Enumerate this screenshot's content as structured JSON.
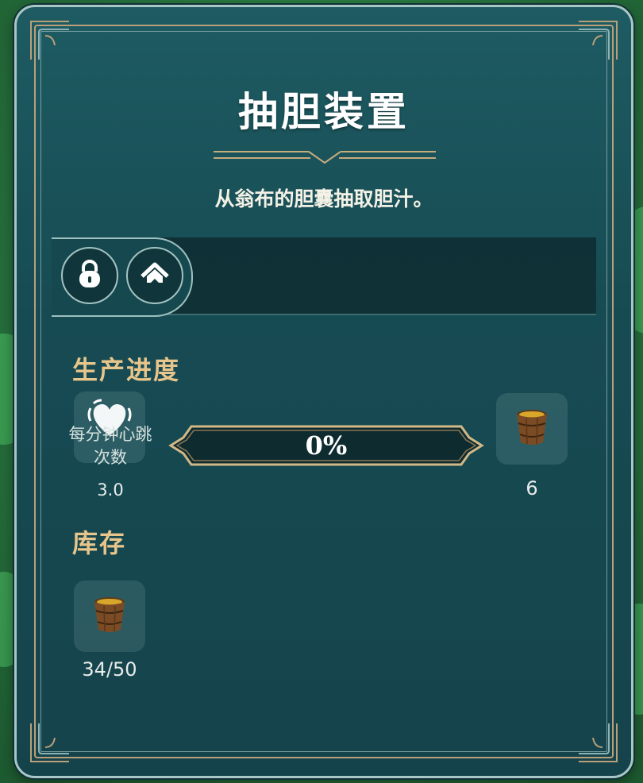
{
  "panel": {
    "title": "抽胆装置",
    "description": "从翁布的胆囊抽取胆汁。"
  },
  "tabs": [
    {
      "icon": "lock-icon"
    },
    {
      "icon": "house-icon"
    }
  ],
  "production": {
    "heading": "生产进度",
    "input": {
      "icon": "heart-icon",
      "label": "每分钟心跳次数",
      "value": "3.0"
    },
    "progress": {
      "text": "0%",
      "fraction": 0
    },
    "output": {
      "icon": "bucket-icon",
      "value": "6"
    }
  },
  "inventory": {
    "heading": "库存",
    "items": [
      {
        "icon": "bucket-icon",
        "count": "34/50"
      }
    ]
  },
  "colors": {
    "panel": "#174b53",
    "gold": "#b9a07a",
    "heading": "#e7c58b",
    "text": "#ffffff"
  }
}
